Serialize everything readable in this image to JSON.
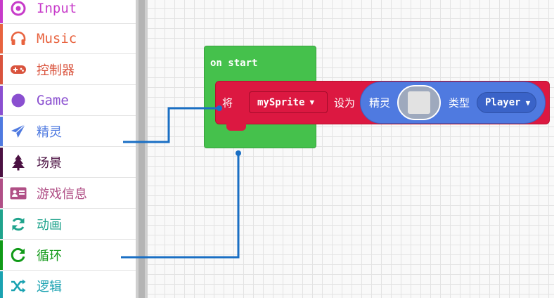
{
  "toolbox": {
    "categories": [
      {
        "label": "Input",
        "color": "#c73ac9",
        "icon": "target-icon"
      },
      {
        "label": "Music",
        "color": "#e8633f",
        "icon": "headphones-icon"
      },
      {
        "label": "控制器",
        "color": "#d9533d",
        "icon": "gamepad-icon"
      },
      {
        "label": "Game",
        "color": "#8a4fd0",
        "icon": "circle-icon"
      },
      {
        "label": "精灵",
        "color": "#4f7ae0",
        "icon": "paper-plane-icon"
      },
      {
        "label": "场景",
        "color": "#4b1142",
        "icon": "tree-icon"
      },
      {
        "label": "游戏信息",
        "color": "#b04f86",
        "icon": "id-card-icon"
      },
      {
        "label": "动画",
        "color": "#1fa38c",
        "icon": "refresh-icon"
      },
      {
        "label": "循环",
        "color": "#109a17",
        "icon": "loop-icon"
      },
      {
        "label": "逻辑",
        "color": "#1aa2b1",
        "icon": "shuffle-icon"
      }
    ]
  },
  "workspace": {
    "on_start": {
      "label": "on start",
      "color": "#45c14c"
    },
    "set_block": {
      "word_set": "将",
      "variable": "mySprite",
      "word_to": "设为",
      "color": "#dc1841"
    },
    "sprite_reporter": {
      "word_sprite": "精灵",
      "word_kind": "类型",
      "kind": "Player",
      "color": "#4f7ae0"
    }
  }
}
